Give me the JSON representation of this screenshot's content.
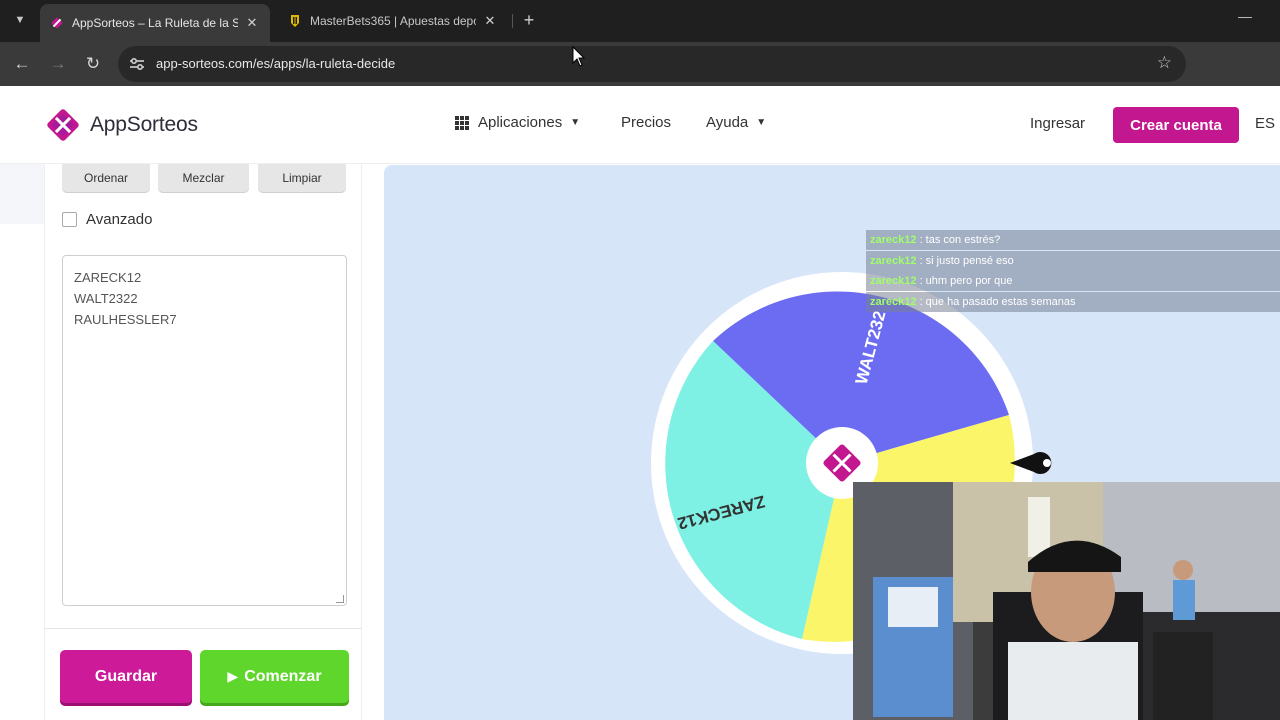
{
  "browser": {
    "tabs": [
      {
        "title": "AppSorteos – La Ruleta de la Su",
        "active": true
      },
      {
        "title": "MasterBets365 | Apuestas depo",
        "active": false
      }
    ],
    "url": "app-sorteos.com/es/apps/la-ruleta-decide"
  },
  "header": {
    "logo_prefix": "App",
    "logo_suffix": "Sorteos",
    "nav": {
      "apps": "Aplicaciones",
      "prices": "Precios",
      "help": "Ayuda"
    },
    "login": "Ingresar",
    "create_account": "Crear cuenta",
    "lang": "ES"
  },
  "panel": {
    "sort": "Ordenar",
    "shuffle": "Mezclar",
    "clear": "Limpiar",
    "advanced": "Avanzado",
    "names": [
      "ZARECK12",
      "WALT2322",
      "RAULHESSLER7"
    ],
    "save": "Guardar",
    "start": "Comenzar"
  },
  "wheel": {
    "segments": [
      {
        "label": "WALT232",
        "color": "#6c6cf2"
      },
      {
        "label": "ZARECK12",
        "color": "#7ef0e4"
      },
      {
        "label": "",
        "color": "#fbf56a"
      }
    ]
  },
  "chat": [
    {
      "user": "zareck12",
      "msg": ": tas con estrés?"
    },
    {
      "user": "zareck12",
      "msg": ": si justo pensé eso"
    },
    {
      "user": "zareck12",
      "msg": ": uhm pero por que"
    },
    {
      "user": "zareck12",
      "msg": ": que ha pasado estas semanas"
    }
  ],
  "colors": {
    "brand": "#c2178f",
    "start": "#5fd62c",
    "wheel_bg": "#d6e5f8"
  }
}
